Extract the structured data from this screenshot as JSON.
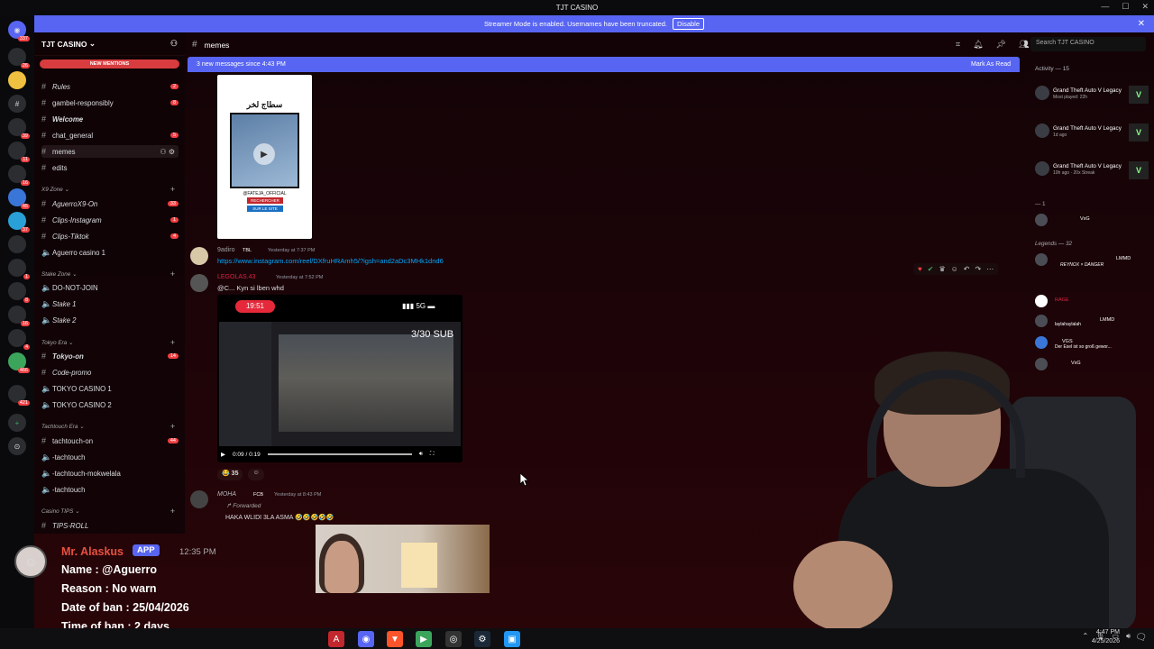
{
  "window": {
    "title": "TJT CASINO"
  },
  "banner": {
    "text": "Streamer Mode is enabled. Usernames have been truncated.",
    "button": "Disable"
  },
  "server_rail": {
    "badges": [
      "337",
      "26",
      "39",
      "11",
      "10",
      "16",
      "45",
      "37",
      "2",
      "1",
      "8",
      "16",
      "4",
      "466",
      "421"
    ]
  },
  "server": {
    "name": "TJT CASINO",
    "new_mentions": "NEW MENTIONS"
  },
  "channels": [
    {
      "label": "Rules",
      "badge": "2",
      "italic": true
    },
    {
      "label": "gambel-responsibly",
      "badge": "8"
    },
    {
      "label": "Welcome",
      "badge": "",
      "italic": true
    },
    {
      "label": "chat_general",
      "badge": "5"
    },
    {
      "label": "memes",
      "badge": "",
      "selected": true
    },
    {
      "label": "edits",
      "badge": ""
    }
  ],
  "categories": [
    {
      "name": "X9 Zone",
      "items": [
        {
          "label": "AguerroX9-On",
          "badge": "33"
        },
        {
          "label": "Clips-Instagram",
          "badge": "1"
        },
        {
          "label": "Clips-Tiktok",
          "badge": "4"
        },
        {
          "label": "Aguerro casino 1",
          "badge": ""
        }
      ]
    },
    {
      "name": "Stake Zone",
      "items": [
        {
          "label": "DO-NOT-JOIN",
          "badge": ""
        },
        {
          "label": "Stake 1",
          "badge": ""
        },
        {
          "label": "Stake 2",
          "badge": ""
        }
      ]
    },
    {
      "name": "Tokyo Era",
      "items": [
        {
          "label": "Tokyo-on",
          "badge": "14"
        },
        {
          "label": "Code-promo",
          "badge": ""
        },
        {
          "label": "TOKYO CASINO 1",
          "badge": ""
        },
        {
          "label": "TOKYO CASINO 2",
          "badge": ""
        }
      ]
    },
    {
      "name": "Tachtouch Era",
      "items": [
        {
          "label": "tachtouch-on",
          "badge": "44"
        },
        {
          "label": "-tachtouch",
          "badge": ""
        },
        {
          "label": "-tachtouch-mokwelala",
          "badge": ""
        },
        {
          "label": "-tachtouch",
          "badge": ""
        }
      ]
    },
    {
      "name": "Casino TIPS",
      "items": [
        {
          "label": "TIPS-ROLL",
          "badge": ""
        }
      ]
    }
  ],
  "topbar": {
    "channel": "memes",
    "search_placeholder": "Search TJT CASINO"
  },
  "newbar": {
    "text": "3 new messages since 4:43 PM",
    "action": "Mark As Read"
  },
  "poster": {
    "arabic": "سطاج لخر",
    "handle": "@FATEJA_OFFICIAL",
    "btn1": "RECHERCHER",
    "btn2": "SUR LE SITE"
  },
  "messages": [
    {
      "user": "9adiro",
      "tag": "TBL",
      "time": "Yesterday at 7:37 PM",
      "link": "https://www.instagram.com/reel/DXfruHRAmh5/?igsh=and2aDc3MHk1dnd6"
    },
    {
      "user": "LEGOLAS.43",
      "time": "Yesterday at 7:52 PM",
      "text": "@C... Kyn si lben whd"
    },
    {
      "user": "MOHA",
      "tag": "FCB",
      "time": "Yesterday at 8:43 PM",
      "forwarded": "Forwarded",
      "text": "HAKA WLIDI 3LA ASMA 🤣🤣🤣🤣🤣"
    }
  ],
  "video": {
    "phone_time": "19:51",
    "signal": "5G",
    "sub": "3/30 SUB",
    "progress": "0:09 / 0:19",
    "reaction_count": "35"
  },
  "members": {
    "activity": "Activity — 15",
    "activities": [
      {
        "game": "Grand Theft Auto V Legacy",
        "sub": "Most played: 22h"
      },
      {
        "game": "Grand Theft Auto V Legacy",
        "sub": "1d ago"
      },
      {
        "game": "Grand Theft Auto V Legacy",
        "sub": "10h ago · 20x Streak"
      }
    ],
    "section1": "— 1",
    "section2": "Legends — 32",
    "rows": [
      {
        "name": "VxG",
        "tag": ""
      },
      {
        "name": "LMMD",
        "tag": "REYNOX × DANGER"
      },
      {
        "name": "RAGE",
        "tag": ""
      },
      {
        "name": "laylahaylalah",
        "tag": "LMMD"
      },
      {
        "name": "Der Esel ist so groß gewor...",
        "tag": "VGS"
      },
      {
        "name": "VxG",
        "tag": ""
      }
    ]
  },
  "overlay": {
    "name": "Mr. Alaskus",
    "app": "APP",
    "time": "12:35 PM",
    "lines": [
      "Name : @Aguerro",
      "Reason : No warn",
      "Date of ban : 25/04/2026",
      "Time of ban : 2 days"
    ]
  },
  "clock": {
    "time": "4:47 PM",
    "date": "4/25/2026"
  }
}
